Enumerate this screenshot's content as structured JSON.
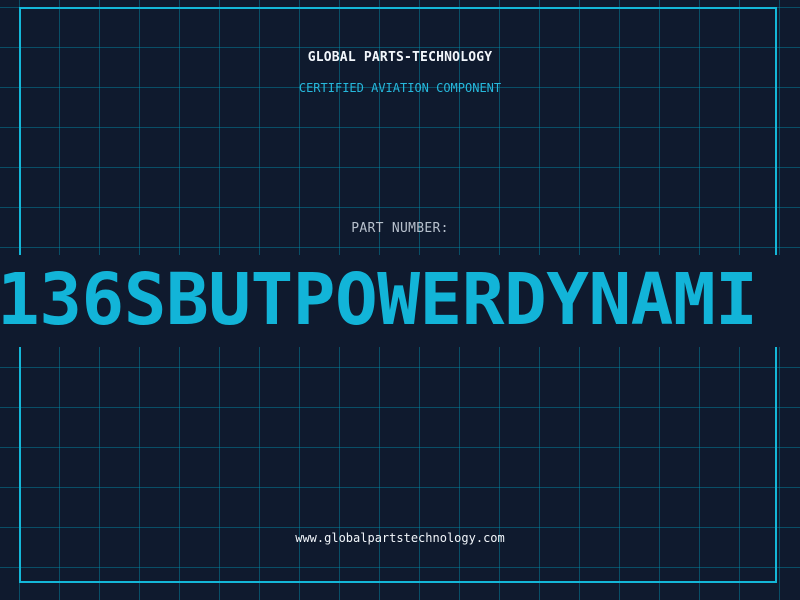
{
  "header": {
    "brand": "GLOBAL PARTS-TECHNOLOGY",
    "tagline": "CERTIFIED AVIATION COMPONENT"
  },
  "part": {
    "label": "PART NUMBER:",
    "number": "136SBUTPOWERDYNAMI"
  },
  "footer": {
    "url": "www.globalpartstechnology.com"
  },
  "colors": {
    "background": "#0f1a2e",
    "accent": "#14b7d8",
    "grid": "#0f6a80",
    "text": "#f2f6fb",
    "muted": "#b7c0cc"
  }
}
